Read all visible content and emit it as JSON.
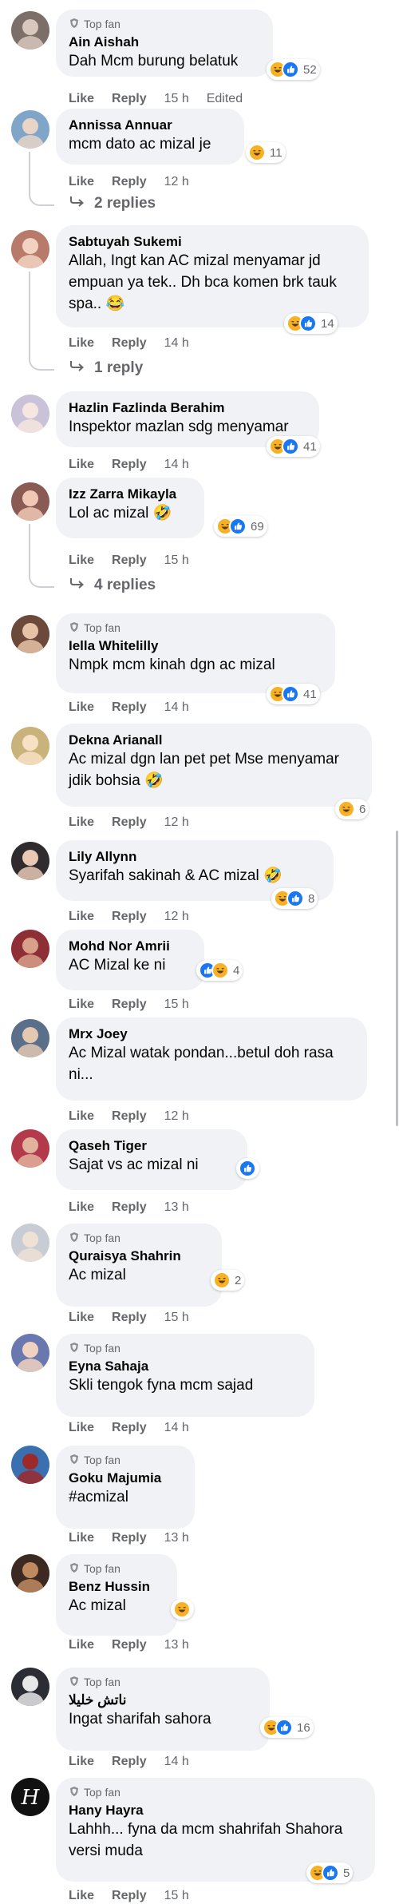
{
  "labels": {
    "like": "Like",
    "reply": "Reply",
    "top_fan": "Top fan",
    "edited": "Edited"
  },
  "colors": {
    "like_blue": "#1877f2",
    "haha_yellow": "#f7b125",
    "meta_grey": "#65676b",
    "bubble_grey": "#f0f2f5"
  },
  "comments": [
    {
      "name": "Ain Aishah",
      "top_fan": true,
      "text": "Dah Mcm burung belatuk",
      "reactions": [
        "haha",
        "like"
      ],
      "count": "52",
      "time": "15 h",
      "edited": true
    },
    {
      "name": "Annissa Annuar",
      "text": "mcm dato ac mizal je",
      "reactions": [
        "haha"
      ],
      "count": "11",
      "time": "12 h",
      "replies": "2 replies"
    },
    {
      "name": "Sabtuyah Sukemi",
      "text": "Allah, Ingt kan AC mizal menyamar jd empuan ya tek.. Dh bca komen brk tauk spa.. 😂",
      "reactions": [
        "haha",
        "like"
      ],
      "count": "14",
      "time": "14 h",
      "replies": "1 reply"
    },
    {
      "name": "Hazlin Fazlinda Berahim",
      "text": "Inspektor mazlan sdg menyamar",
      "reactions": [
        "haha",
        "like"
      ],
      "count": "41",
      "time": "14 h"
    },
    {
      "name": "Izz Zarra Mikayla",
      "text": "Lol ac mizal 🤣",
      "reactions": [
        "haha",
        "like"
      ],
      "count": "69",
      "time": "15 h",
      "replies": "4 replies"
    },
    {
      "name": "Iella Whitelilly",
      "top_fan": true,
      "text": "Nmpk mcm kinah dgn ac mizal",
      "reactions": [
        "haha",
        "like"
      ],
      "count": "41",
      "time": "14 h"
    },
    {
      "name": "Dekna Arianall",
      "text": "Ac mizal dgn lan pet pet Mse menyamar jdik bohsia 🤣",
      "reactions": [
        "haha"
      ],
      "count": "6",
      "time": "12 h"
    },
    {
      "name": "Lily Allynn",
      "text": "Syarifah sakinah & AC mizal 🤣",
      "reactions": [
        "haha",
        "like"
      ],
      "count": "8",
      "time": "12 h"
    },
    {
      "name": "Mohd Nor Amrii",
      "text": "AC Mizal ke ni",
      "reactions": [
        "like",
        "haha"
      ],
      "count": "4",
      "time": "15 h"
    },
    {
      "name": "Mrx Joey",
      "text": "Ac Mizal watak pondan...betul doh rasa ni...",
      "reactions": [],
      "count": "",
      "time": "12 h"
    },
    {
      "name": "Qaseh Tiger",
      "text": "Sajat vs ac mizal ni",
      "reactions": [
        "like"
      ],
      "count": "",
      "time": "13 h"
    },
    {
      "name": "Quraisya Shahrin",
      "top_fan": true,
      "text": "Ac mizal",
      "reactions": [
        "haha"
      ],
      "count": "2",
      "time": "15 h"
    },
    {
      "name": "Eyna Sahaja",
      "top_fan": true,
      "text": "Skli tengok fyna mcm sajad",
      "reactions": [],
      "count": "",
      "time": "14 h"
    },
    {
      "name": "Goku Majumia",
      "top_fan": true,
      "text": "#acmizal",
      "reactions": [],
      "count": "",
      "time": "13 h"
    },
    {
      "name": "Benz Hussin",
      "top_fan": true,
      "text": "Ac mizal",
      "reactions": [
        "haha"
      ],
      "count": "",
      "time": "13 h"
    },
    {
      "name": "ناتش خليلا",
      "top_fan": true,
      "text": "Ingat sharifah sahora",
      "reactions": [
        "haha",
        "like"
      ],
      "count": "16",
      "time": "14 h"
    },
    {
      "name": "Hany Hayra",
      "top_fan": true,
      "text": "Lahhh... fyna da mcm shahrifah Shahora versi muda",
      "reactions": [
        "haha",
        "like"
      ],
      "count": "5",
      "time": "15 h"
    }
  ]
}
